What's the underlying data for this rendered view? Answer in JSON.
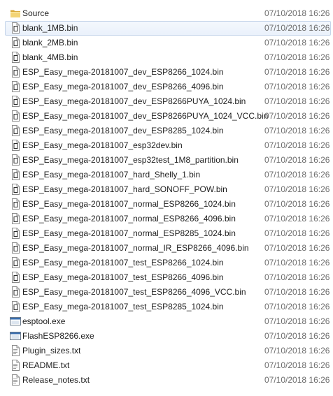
{
  "files": [
    {
      "name": "Source",
      "modified": "07/10/2018 16:26",
      "type": "folder",
      "icon": "folder-icon"
    },
    {
      "name": "blank_1MB.bin",
      "modified": "07/10/2018 16:26",
      "type": "bin",
      "icon": "bin-file-icon",
      "selected": true
    },
    {
      "name": "blank_2MB.bin",
      "modified": "07/10/2018 16:26",
      "type": "bin",
      "icon": "bin-file-icon"
    },
    {
      "name": "blank_4MB.bin",
      "modified": "07/10/2018 16:26",
      "type": "bin",
      "icon": "bin-file-icon"
    },
    {
      "name": "ESP_Easy_mega-20181007_dev_ESP8266_1024.bin",
      "modified": "07/10/2018 16:26",
      "type": "bin",
      "icon": "bin-file-icon"
    },
    {
      "name": "ESP_Easy_mega-20181007_dev_ESP8266_4096.bin",
      "modified": "07/10/2018 16:26",
      "type": "bin",
      "icon": "bin-file-icon"
    },
    {
      "name": "ESP_Easy_mega-20181007_dev_ESP8266PUYA_1024.bin",
      "modified": "07/10/2018 16:26",
      "type": "bin",
      "icon": "bin-file-icon"
    },
    {
      "name": "ESP_Easy_mega-20181007_dev_ESP8266PUYA_1024_VCC.bin",
      "modified": "07/10/2018 16:26",
      "type": "bin",
      "icon": "bin-file-icon"
    },
    {
      "name": "ESP_Easy_mega-20181007_dev_ESP8285_1024.bin",
      "modified": "07/10/2018 16:26",
      "type": "bin",
      "icon": "bin-file-icon"
    },
    {
      "name": "ESP_Easy_mega-20181007_esp32dev.bin",
      "modified": "07/10/2018 16:26",
      "type": "bin",
      "icon": "bin-file-icon"
    },
    {
      "name": "ESP_Easy_mega-20181007_esp32test_1M8_partition.bin",
      "modified": "07/10/2018 16:26",
      "type": "bin",
      "icon": "bin-file-icon"
    },
    {
      "name": "ESP_Easy_mega-20181007_hard_Shelly_1.bin",
      "modified": "07/10/2018 16:26",
      "type": "bin",
      "icon": "bin-file-icon"
    },
    {
      "name": "ESP_Easy_mega-20181007_hard_SONOFF_POW.bin",
      "modified": "07/10/2018 16:26",
      "type": "bin",
      "icon": "bin-file-icon"
    },
    {
      "name": "ESP_Easy_mega-20181007_normal_ESP8266_1024.bin",
      "modified": "07/10/2018 16:26",
      "type": "bin",
      "icon": "bin-file-icon"
    },
    {
      "name": "ESP_Easy_mega-20181007_normal_ESP8266_4096.bin",
      "modified": "07/10/2018 16:26",
      "type": "bin",
      "icon": "bin-file-icon"
    },
    {
      "name": "ESP_Easy_mega-20181007_normal_ESP8285_1024.bin",
      "modified": "07/10/2018 16:26",
      "type": "bin",
      "icon": "bin-file-icon"
    },
    {
      "name": "ESP_Easy_mega-20181007_normal_IR_ESP8266_4096.bin",
      "modified": "07/10/2018 16:26",
      "type": "bin",
      "icon": "bin-file-icon"
    },
    {
      "name": "ESP_Easy_mega-20181007_test_ESP8266_1024.bin",
      "modified": "07/10/2018 16:26",
      "type": "bin",
      "icon": "bin-file-icon"
    },
    {
      "name": "ESP_Easy_mega-20181007_test_ESP8266_4096.bin",
      "modified": "07/10/2018 16:26",
      "type": "bin",
      "icon": "bin-file-icon"
    },
    {
      "name": "ESP_Easy_mega-20181007_test_ESP8266_4096_VCC.bin",
      "modified": "07/10/2018 16:26",
      "type": "bin",
      "icon": "bin-file-icon"
    },
    {
      "name": "ESP_Easy_mega-20181007_test_ESP8285_1024.bin",
      "modified": "07/10/2018 16:26",
      "type": "bin",
      "icon": "bin-file-icon"
    },
    {
      "name": "esptool.exe",
      "modified": "07/10/2018 16:26",
      "type": "exe",
      "icon": "exe-file-icon"
    },
    {
      "name": "FlashESP8266.exe",
      "modified": "07/10/2018 16:26",
      "type": "exe",
      "icon": "exe-file-icon"
    },
    {
      "name": "Plugin_sizes.txt",
      "modified": "07/10/2018 16:26",
      "type": "txt",
      "icon": "txt-file-icon"
    },
    {
      "name": "README.txt",
      "modified": "07/10/2018 16:26",
      "type": "txt",
      "icon": "txt-file-icon"
    },
    {
      "name": "Release_notes.txt",
      "modified": "07/10/2018 16:26",
      "type": "txt",
      "icon": "txt-file-icon"
    }
  ],
  "colors": {
    "selection_border": "#c5d5ea",
    "selection_fill": "#eaf1fb",
    "date_text": "#6d6d6d",
    "folder": "#e8c25a"
  }
}
